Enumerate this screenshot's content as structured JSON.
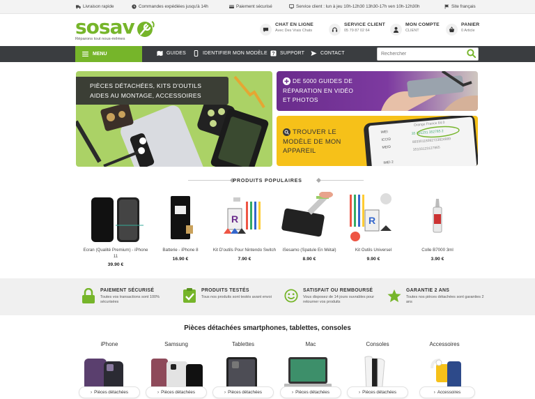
{
  "topbar": {
    "items": [
      {
        "icon": "truck-icon",
        "label": "Livraison rapide"
      },
      {
        "icon": "clock-icon",
        "label": "Commandes expédiées jusqu'à 14h"
      },
      {
        "icon": "card-icon",
        "label": "Paiement sécurisé"
      },
      {
        "icon": "monitor-icon",
        "label": "Service client : lun à jeu 10h-12h30 13h30-17h ven 10h-12h30h"
      },
      {
        "icon": "flag-icon",
        "label": "Site français"
      }
    ]
  },
  "header": {
    "logo": "sosav",
    "tagline": "Réparons tout nous-mêmes",
    "chat": {
      "title": "CHAT EN LIGNE",
      "sub": "Avec Des Vrais Chats"
    },
    "service": {
      "title": "SERVICE CLIENT",
      "sub": "05 79 87 02 64"
    },
    "account": {
      "title": "MON COMPTE",
      "sub": "CLIENT"
    },
    "cart": {
      "title": "PANIER",
      "sub": "0 Article"
    }
  },
  "nav": {
    "menu": "MENU",
    "links": [
      "GUIDES",
      "IDENTIFIER MON MODÈLE",
      "SUPPORT",
      "CONTACT"
    ],
    "search_placeholder": "Rechercher"
  },
  "banners": {
    "main_line1": "PIÈCES DÉTACHÉES, KITS D'OUTILS",
    "main_line2": "AIDES AU MONTAGE, ACCESSOIRES",
    "top_line1": "DE 5000 GUIDES DE",
    "top_line2": "RÉPARATION EN VIDÉO",
    "top_line3": "ET PHOTOS",
    "bot_line1": "TROUVER LE",
    "bot_line2": "MODÈLE DE MON",
    "bot_line3": "APPAREIL"
  },
  "popular": {
    "title": "PRODUITS POPULAIRES",
    "products": [
      {
        "name": "Ecran (Qualité Premium) - iPhone 11",
        "price": "39.90 €"
      },
      {
        "name": "Batterie - iPhone 8",
        "price": "16.90 €"
      },
      {
        "name": "Kit D'outils Pour Nintendo Switch",
        "price": "7.90 €"
      },
      {
        "name": "iSesamo (Spatule En Métal)",
        "price": "8.90 €"
      },
      {
        "name": "Kit Outils Universel",
        "price": "9.90 €"
      },
      {
        "name": "Colle B7000 3ml",
        "price": "3.90 €"
      }
    ]
  },
  "features": [
    {
      "icon": "lock-icon",
      "title": "PAIEMENT SÉCURISÉ",
      "desc": "Toutes vos transactions sont 100% sécurisées"
    },
    {
      "icon": "check-icon",
      "title": "PRODUITS TESTÉS",
      "desc": "Tous nos produits sont testés avant envoi"
    },
    {
      "icon": "smiley-icon",
      "title": "SATISFAIT OU REMBOURSÉ",
      "desc": "Vous disposez de 14 jours ouvrables pour retourner vos produits"
    },
    {
      "icon": "star-icon",
      "title": "GARANTIE 2 ANS",
      "desc": "Toutes nos pièces détachées sont garanties 2 ans"
    }
  ],
  "categories": {
    "title": "Pièces détachées smartphones, tablettes, consoles",
    "items": [
      {
        "name": "iPhone",
        "button": "Pièces détachées"
      },
      {
        "name": "Samsung",
        "button": "Pièces détachées"
      },
      {
        "name": "Tablettes",
        "button": "Pièces détachées"
      },
      {
        "name": "Mac",
        "button": "Pièces détachées"
      },
      {
        "name": "Consoles",
        "button": "Pièces détachées"
      },
      {
        "name": "Accessoires",
        "button": "Accessoires"
      }
    ]
  },
  "colors": {
    "brand_green": "#76b52a",
    "nav_dark": "#3a3d40",
    "purple": "#6a2c8c",
    "yellow": "#f6c119"
  }
}
